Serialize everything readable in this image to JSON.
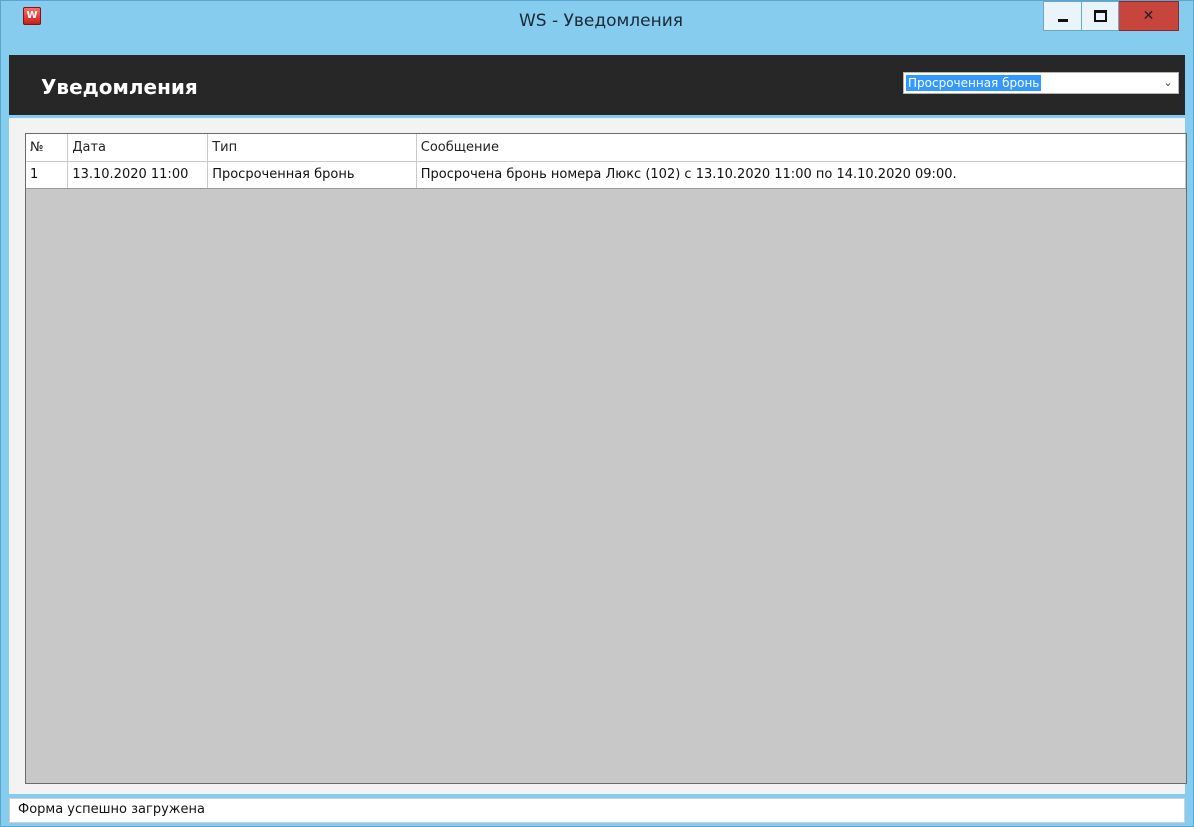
{
  "window": {
    "title": "WS - Уведомления",
    "app_icon": "app-logo-icon",
    "controls": [
      "minimize",
      "maximize",
      "close"
    ]
  },
  "header": {
    "title": "Уведомления",
    "filter": {
      "selected": "Просроченная бронь",
      "arrow": "chevron-down"
    }
  },
  "grid": {
    "columns": [
      "№",
      "Дата",
      "Тип",
      "Сообщение"
    ],
    "rows": [
      {
        "num": "1",
        "date": "13.10.2020 11:00",
        "type": "Просроченная бронь",
        "message": "Просрочена бронь номера Люкс (102) с 13.10.2020 11:00 по 14.10.2020 09:00."
      }
    ]
  },
  "status": {
    "text": "Форма успешно загружена"
  },
  "colors": {
    "titlebar": "#86ccef",
    "header": "#272727",
    "grid_empty": "#c8c8c8",
    "selection": "#3399ff",
    "close_button": "#c7453d"
  }
}
